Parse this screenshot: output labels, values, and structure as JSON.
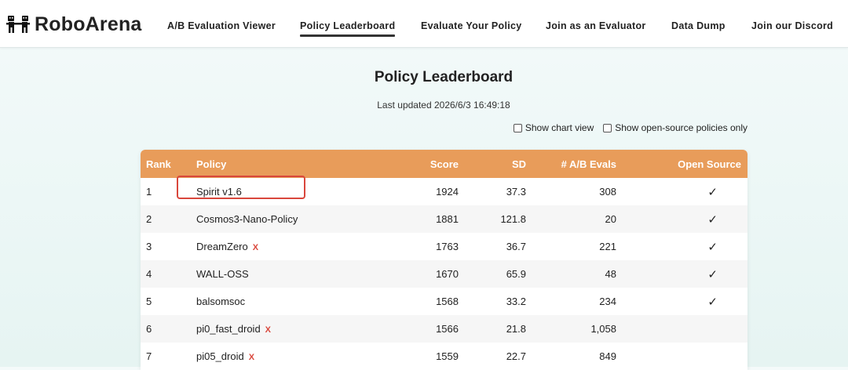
{
  "brand": {
    "name": "RoboArena",
    "icon": "robots-fighting-icon"
  },
  "nav": [
    {
      "label": "A/B Evaluation Viewer",
      "active": false
    },
    {
      "label": "Policy Leaderboard",
      "active": true
    },
    {
      "label": "Evaluate Your Policy",
      "active": false
    },
    {
      "label": "Join as an Evaluator",
      "active": false
    },
    {
      "label": "Data Dump",
      "active": false
    },
    {
      "label": "Join our Discord",
      "active": false
    }
  ],
  "page": {
    "title": "Policy Leaderboard",
    "last_updated": "Last updated 2026/6/3 16:49:18"
  },
  "options": {
    "chart_view": "Show chart view",
    "open_source_only": "Show open-source policies only"
  },
  "table": {
    "headers": [
      "Rank",
      "Policy",
      "Score",
      "SD",
      "# A/B Evals",
      "Open Source"
    ],
    "rows": [
      {
        "rank": "1",
        "policy": "Spirit v1.6",
        "score": "1924",
        "sd": "37.3",
        "evals": "308",
        "open_source": "✓",
        "x_mark": "",
        "highlighted": true
      },
      {
        "rank": "2",
        "policy": "Cosmos3-Nano-Policy",
        "score": "1881",
        "sd": "121.8",
        "evals": "20",
        "open_source": "✓",
        "x_mark": ""
      },
      {
        "rank": "3",
        "policy": "DreamZero",
        "score": "1763",
        "sd": "36.7",
        "evals": "221",
        "open_source": "✓",
        "x_mark": "X"
      },
      {
        "rank": "4",
        "policy": "WALL-OSS",
        "score": "1670",
        "sd": "65.9",
        "evals": "48",
        "open_source": "✓",
        "x_mark": ""
      },
      {
        "rank": "5",
        "policy": "balsomsoc",
        "score": "1568",
        "sd": "33.2",
        "evals": "234",
        "open_source": "✓",
        "x_mark": ""
      },
      {
        "rank": "6",
        "policy": "pi0_fast_droid",
        "score": "1566",
        "sd": "21.8",
        "evals": "1,058",
        "open_source": "",
        "x_mark": "X"
      },
      {
        "rank": "7",
        "policy": "pi05_droid",
        "score": "1559",
        "sd": "22.7",
        "evals": "849",
        "open_source": "",
        "x_mark": "X"
      }
    ]
  },
  "colors": {
    "header_bg": "#e89c5a",
    "highlight_border": "#d9473c",
    "x_mark": "#d9473c"
  }
}
